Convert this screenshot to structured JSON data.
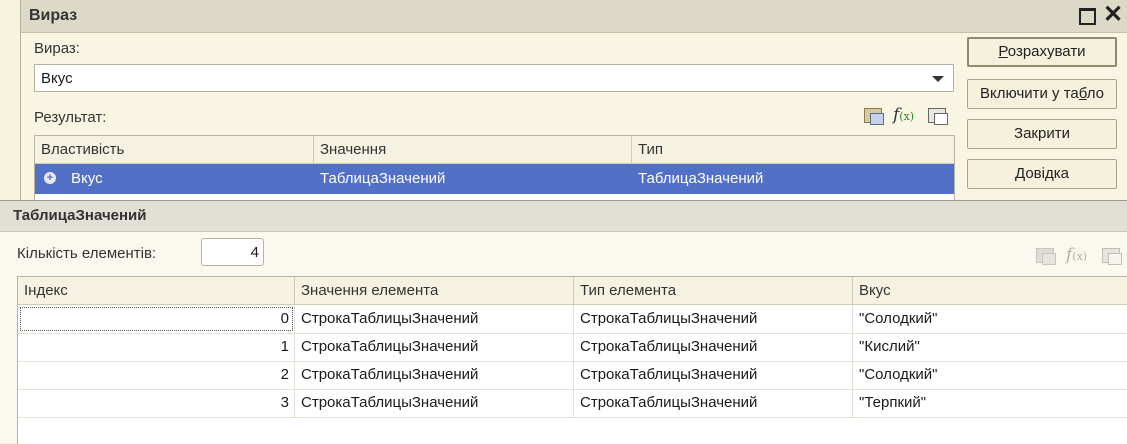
{
  "expression_window": {
    "title": "Вираз",
    "expression_label": "Вираз:",
    "expression_value": "Вкус",
    "result_label": "Результат:",
    "columns": [
      "Властивість",
      "Значення",
      "Тип"
    ],
    "rows": [
      {
        "property": "Вкус",
        "value": "ТаблицаЗначений",
        "type": "ТаблицаЗначений"
      }
    ],
    "buttons": {
      "calculate": "Розрахувати",
      "add_to_board": "Включити у табло",
      "close": "Закрити",
      "help": "Довідка"
    },
    "icons": [
      "open-icon",
      "function-icon",
      "print-icon"
    ]
  },
  "value_table_window": {
    "title": "ТаблицаЗначений",
    "count_label": "Кількість елементів:",
    "count_value": "4",
    "columns": [
      "Індекс",
      "Значення елемента",
      "Тип елемента",
      "Вкус"
    ],
    "rows": [
      {
        "index": "0",
        "value": "СтрокаТаблицыЗначений",
        "type": "СтрокаТаблицыЗначений",
        "taste": "\"Солодкий\""
      },
      {
        "index": "1",
        "value": "СтрокаТаблицыЗначений",
        "type": "СтрокаТаблицыЗначений",
        "taste": "\"Кислий\""
      },
      {
        "index": "2",
        "value": "СтрокаТаблицыЗначений",
        "type": "СтрокаТаблицыЗначений",
        "taste": "\"Солодкий\""
      },
      {
        "index": "3",
        "value": "СтрокаТаблицыЗначений",
        "type": "СтрокаТаблицыЗначений",
        "taste": "\"Терпкий\""
      }
    ]
  },
  "colors": {
    "selection": "#5370c7",
    "window_bg": "#f8f5e2",
    "title_bar": "#dcd9c6"
  }
}
